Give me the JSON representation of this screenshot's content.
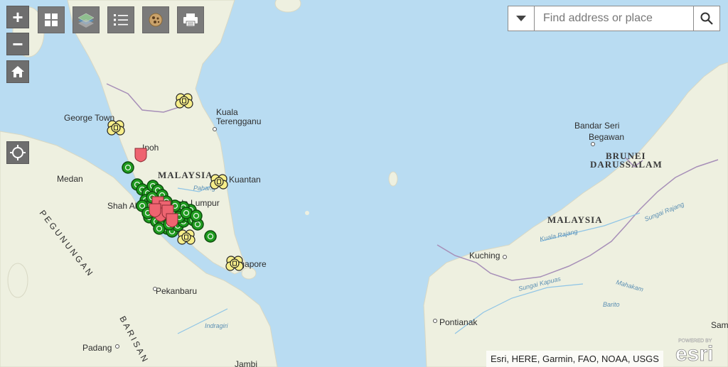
{
  "map": {
    "country_labels": [
      "MALAYSIA",
      "MALAYSIA",
      "BRUNEI",
      "DARUSSALAM"
    ],
    "city_labels": [
      "George Town",
      "Ipoh",
      "Kuala",
      "Terengganu",
      "Medan",
      "Kuantan",
      "Shah Alam",
      "Kuala Lumpur",
      "Singapore",
      "Pekanbaru",
      "Padang",
      "Jambi",
      "Kuching",
      "Pontianak",
      "Bandar Seri",
      "Begawan",
      "Sam"
    ],
    "range_labels": [
      "PEGUNUNGAN",
      "BARISAN"
    ],
    "river_labels": [
      "Pahang",
      "Indragiri",
      "Sungai Kapuas",
      "Kuala Rajang",
      "Sungai Rajang",
      "Mahakam",
      "Barito"
    ]
  },
  "controls": {
    "zoom_in": "+",
    "zoom_out": "−",
    "home_icon": "home-icon",
    "locate_icon": "locate-icon"
  },
  "toolbar": [
    "basemap-gallery-icon",
    "layers-icon",
    "legend-icon",
    "bookmarks-icon",
    "print-icon"
  ],
  "search": {
    "placeholder": "Find address or place"
  },
  "attribution": "Esri, HERE, Garmin, FAO, NOAA, USGS",
  "esri_logo": {
    "powered_by": "POWERED BY",
    "brand": "esri"
  },
  "colors": {
    "water": "#b9dcf2",
    "land": "#eef0e0",
    "green_marker": "#1f9b1f",
    "red_marker": "#ee6470",
    "yellow_marker": "#f7ee8a",
    "control_bg": "#6e6e6e"
  }
}
